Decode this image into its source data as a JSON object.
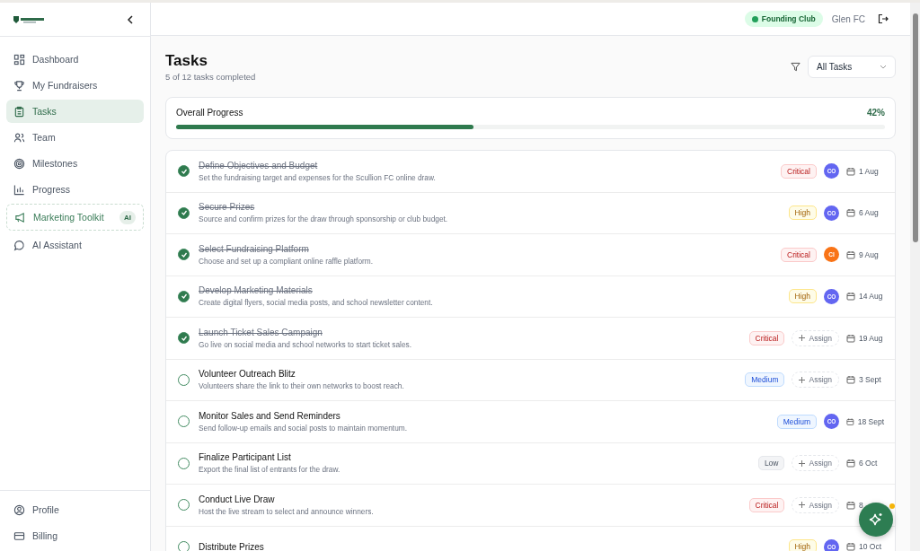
{
  "sidebar": {
    "items": [
      {
        "label": "Dashboard",
        "kind": "normal",
        "selected": false
      },
      {
        "label": "My Fundraisers",
        "kind": "normal",
        "selected": false
      },
      {
        "label": "Tasks",
        "kind": "normal",
        "selected": true
      },
      {
        "label": "Team",
        "kind": "normal",
        "selected": false
      },
      {
        "label": "Milestones",
        "kind": "normal",
        "selected": false
      },
      {
        "label": "Progress",
        "kind": "normal",
        "selected": false
      },
      {
        "label": "Marketing Toolkit",
        "kind": "featured",
        "badge": "AI",
        "selected": false
      },
      {
        "label": "AI Assistant",
        "kind": "normal",
        "selected": false
      }
    ],
    "bottom_items": [
      {
        "label": "Profile"
      },
      {
        "label": "Billing"
      }
    ]
  },
  "header": {
    "badge": "Founding Club",
    "club": "Glen FC"
  },
  "page": {
    "title": "Tasks",
    "subtitle": "5 of 12 tasks completed",
    "filter": {
      "value": "All Tasks"
    }
  },
  "progress": {
    "label": "Overall Progress",
    "reading": "42%",
    "level": 0.42
  },
  "tasks": [
    {
      "title": "Define Objectives and Budget",
      "description": "Set the fundraising target and expenses for the Scullion FC online draw.",
      "checked": true,
      "priority": {
        "label": "Critical",
        "kind": "critical"
      },
      "assignee": {
        "initials": "CO",
        "color": "#6366f1"
      },
      "date": "1 Aug"
    },
    {
      "title": "Secure Prizes",
      "description": "Source and confirm prizes for the draw through sponsorship or club budget.",
      "checked": true,
      "priority": {
        "label": "High",
        "kind": "high"
      },
      "assignee": {
        "initials": "CO",
        "color": "#6366f1"
      },
      "date": "6 Aug"
    },
    {
      "title": "Select Fundraising Platform",
      "description": "Choose and set up a compliant online raffle platform.",
      "checked": true,
      "priority": {
        "label": "Critical",
        "kind": "critical"
      },
      "assignee": {
        "initials": "CI",
        "color": "#f97316"
      },
      "date": "9 Aug"
    },
    {
      "title": "Develop Marketing Materials",
      "description": "Create digital flyers, social media posts, and school newsletter content.",
      "checked": true,
      "priority": {
        "label": "High",
        "kind": "high"
      },
      "assignee": {
        "initials": "CO",
        "color": "#6366f1"
      },
      "date": "14 Aug"
    },
    {
      "title": "Launch Ticket Sales Campaign",
      "description": "Go live on social media and school networks to start ticket sales.",
      "checked": true,
      "priority": {
        "label": "Critical",
        "kind": "critical"
      },
      "assign_label": "Assign",
      "date": "19 Aug"
    },
    {
      "title": "Volunteer Outreach Blitz",
      "description": "Volunteers share the link to their own networks to boost reach.",
      "checked": false,
      "priority": {
        "label": "Medium",
        "kind": "medium"
      },
      "assign_label": "Assign",
      "date": "3 Sept"
    },
    {
      "title": "Monitor Sales and Send Reminders",
      "description": "Send follow-up emails and social posts to maintain momentum.",
      "checked": false,
      "priority": {
        "label": "Medium",
        "kind": "medium"
      },
      "assignee": {
        "initials": "CO",
        "color": "#6366f1"
      },
      "date": "18 Sept"
    },
    {
      "title": "Finalize Participant List",
      "description": "Export the final list of entrants for the draw.",
      "checked": false,
      "priority": {
        "label": "Low",
        "kind": "low"
      },
      "assign_label": "Assign",
      "date": "6 Oct"
    },
    {
      "title": "Conduct Live Draw",
      "description": "Host the live stream to select and announce winners.",
      "checked": false,
      "priority": {
        "label": "Critical",
        "kind": "critical"
      },
      "assign_label": "Assign",
      "date": "8"
    },
    {
      "title": "Distribute Prizes",
      "checked": false,
      "priority": {
        "label": "High",
        "kind": "high"
      },
      "assignee": {
        "initials": "CO",
        "color": "#6366f1"
      },
      "date": "10 Oct"
    }
  ]
}
